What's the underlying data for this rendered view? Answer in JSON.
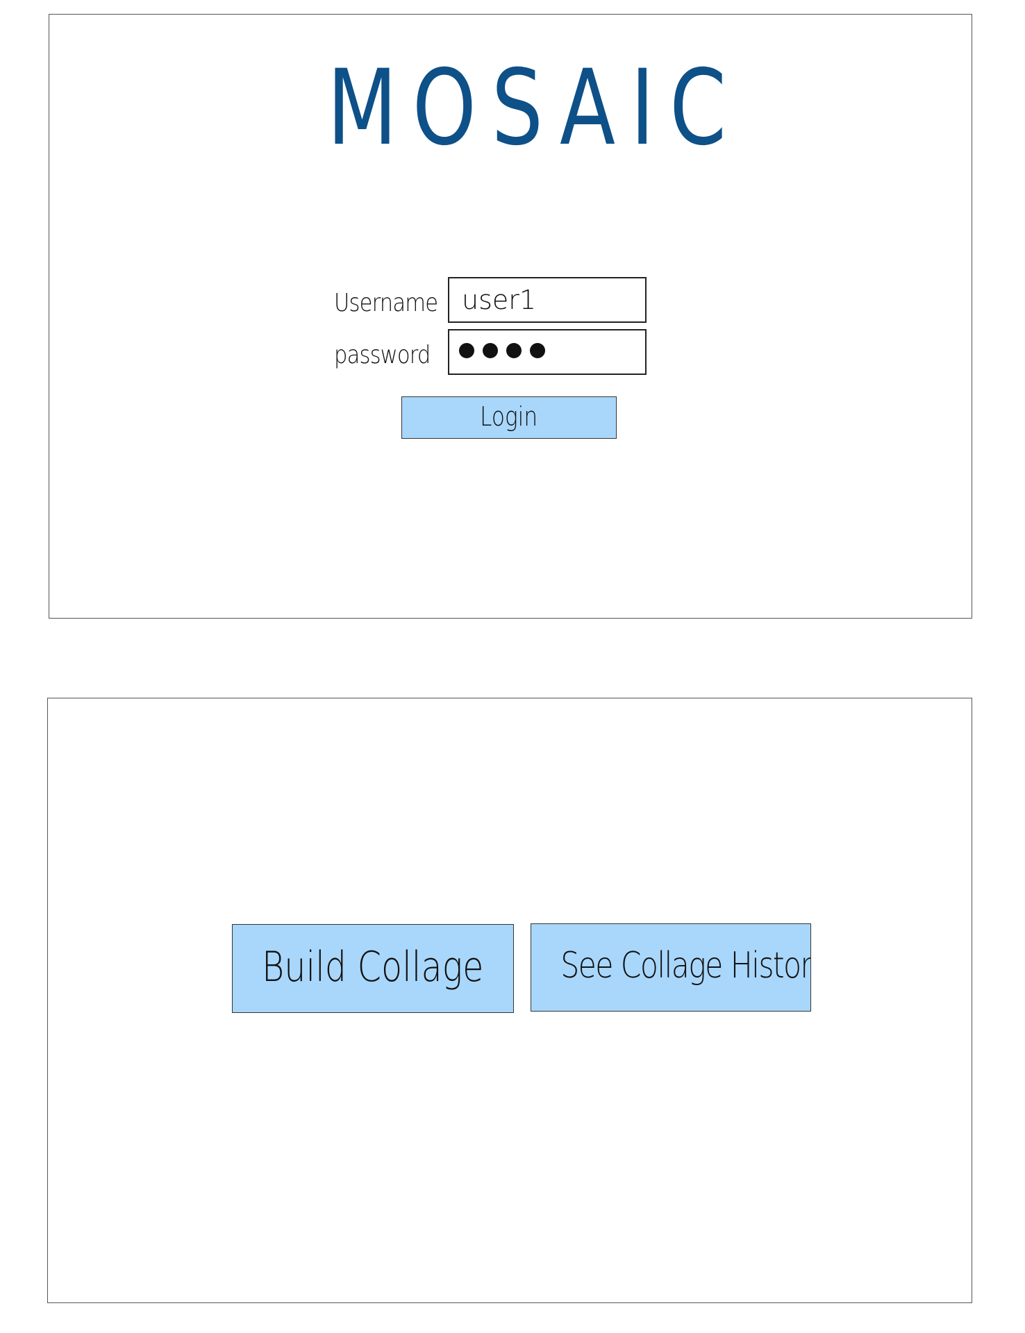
{
  "app": {
    "title": "MOSAIC"
  },
  "login": {
    "username_label": "Username",
    "username_value": "user1",
    "password_label": "password",
    "password_mask_count": 4,
    "login_button": "Login"
  },
  "menu": {
    "build_collage": "Build Collage",
    "see_collage_history": "See Collage History"
  },
  "colors": {
    "title": "#0e5088",
    "button_fill": "#a9d7fb",
    "border": "#333333"
  }
}
